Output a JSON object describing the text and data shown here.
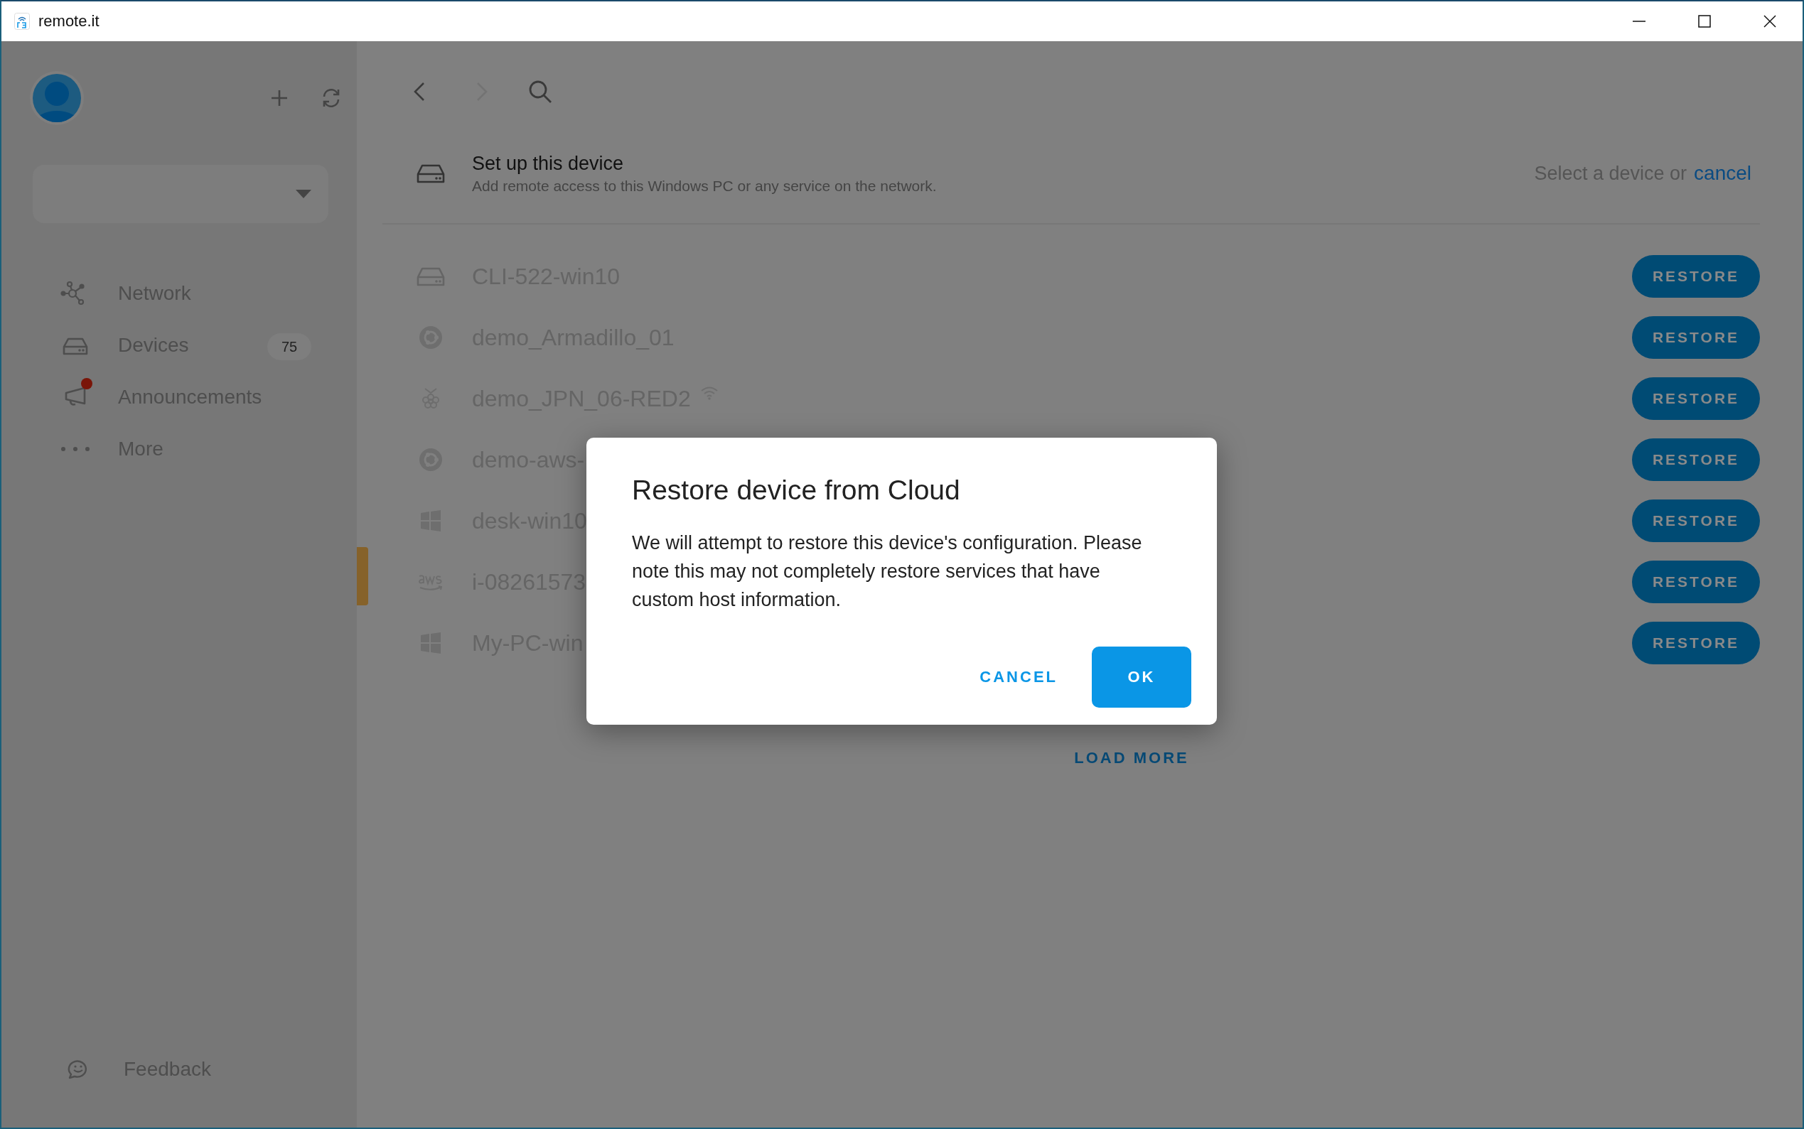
{
  "window": {
    "title": "remote.it"
  },
  "sidebar": {
    "items": [
      {
        "label": "Network",
        "kind": "network"
      },
      {
        "label": "Devices",
        "kind": "devices",
        "badge": "75"
      },
      {
        "label": "Announcements",
        "kind": "announcements",
        "unread": true
      },
      {
        "label": "More",
        "kind": "more"
      }
    ],
    "feedback": "Feedback"
  },
  "setup": {
    "title": "Set up this device",
    "subtitle": "Add remote access to this Windows PC or any service on the network.",
    "prompt": "Select a device or",
    "cancel_link": "cancel"
  },
  "devices": [
    {
      "name": "CLI-522-win10",
      "kind": "drive",
      "wifi": false,
      "action": "RESTORE"
    },
    {
      "name": "demo_Armadillo_01",
      "kind": "ubuntu",
      "wifi": false,
      "action": "RESTORE"
    },
    {
      "name": "demo_JPN_06-RED2",
      "kind": "raspberry",
      "wifi": true,
      "action": "RESTORE"
    },
    {
      "name": "demo-aws-",
      "kind": "ubuntu",
      "wifi": false,
      "action": "RESTORE"
    },
    {
      "name": "desk-win10",
      "kind": "windows",
      "wifi": false,
      "action": "RESTORE"
    },
    {
      "name": "i-08261573",
      "kind": "aws",
      "wifi": false,
      "action": "RESTORE"
    },
    {
      "name": "My-PC-win",
      "kind": "windows",
      "wifi": false,
      "action": "RESTORE"
    }
  ],
  "load_more": "LOAD MORE",
  "dialog": {
    "title": "Restore device from Cloud",
    "body": "We will attempt to restore this device's configuration. Please note this may not completely restore services that have custom host information.",
    "buttons": [
      {
        "label": "CANCEL",
        "kind": "text"
      },
      {
        "label": "OK",
        "kind": "primary"
      }
    ]
  }
}
